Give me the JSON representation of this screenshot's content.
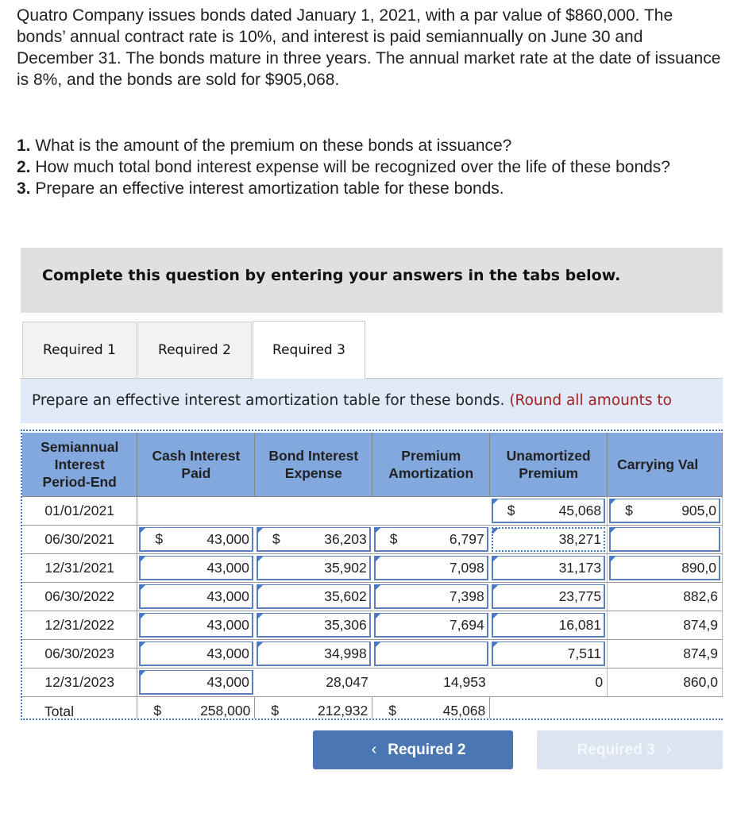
{
  "problem": {
    "text": "Quatro Company issues bonds dated January 1, 2021, with a par value of $860,000. The bonds’ annual contract rate is 10%, and interest is paid semiannually on June 30 and December 31. The bonds mature in three years. The annual market rate at the date of issuance is 8%, and the bonds are sold for $905,068."
  },
  "questions": [
    {
      "num": "1.",
      "text": " What is the amount of the premium on these bonds at issuance?"
    },
    {
      "num": "2.",
      "text": " How much total bond interest expense will be recognized over the life of these bonds?"
    },
    {
      "num": "3.",
      "text": " Prepare an effective interest amortization table for these bonds."
    }
  ],
  "banner": {
    "text": "Complete this question by entering your answers in the tabs below."
  },
  "tabs": [
    {
      "label": "Required 1",
      "active": false
    },
    {
      "label": "Required 2",
      "active": false
    },
    {
      "label": "Required 3",
      "active": true
    }
  ],
  "instruction": {
    "text": "Prepare an effective interest amortization table for these bonds. ",
    "note": "(Round all amounts to"
  },
  "table": {
    "headers": [
      "Semiannual Interest Period-End",
      "Cash Interest Paid",
      "Bond Interest Expense",
      "Premium Amortization",
      "Unamortized Premium",
      "Carrying Val"
    ],
    "rows": [
      {
        "date": "01/01/2021",
        "cash": "",
        "expense": "",
        "amort": "",
        "unamort": "45,068",
        "carrying": "905,0"
      },
      {
        "date": "06/30/2021",
        "cash": "43,000",
        "expense": "36,203",
        "amort": "6,797",
        "unamort": "38,271",
        "carrying": ""
      },
      {
        "date": "12/31/2021",
        "cash": "43,000",
        "expense": "35,902",
        "amort": "7,098",
        "unamort": "31,173",
        "carrying": "890,0"
      },
      {
        "date": "06/30/2022",
        "cash": "43,000",
        "expense": "35,602",
        "amort": "7,398",
        "unamort": "23,775",
        "carrying": "882,6"
      },
      {
        "date": "12/31/2022",
        "cash": "43,000",
        "expense": "35,306",
        "amort": "7,694",
        "unamort": "16,081",
        "carrying": "874,9"
      },
      {
        "date": "06/30/2023",
        "cash": "43,000",
        "expense": "34,998",
        "amort": "",
        "unamort": "7,511",
        "carrying": "874,9"
      },
      {
        "date": "12/31/2023",
        "cash": "43,000",
        "expense": "28,047",
        "amort": "14,953",
        "unamort": "0",
        "carrying": "860,0"
      }
    ],
    "total": {
      "label": "Total",
      "cash": "258,000",
      "expense": "212,932",
      "amort": "45,068"
    },
    "currency": "$"
  },
  "nav": {
    "prev_label": "Required 2",
    "next_label": "Required 3",
    "prev_icon": "‹",
    "next_icon": "›"
  }
}
